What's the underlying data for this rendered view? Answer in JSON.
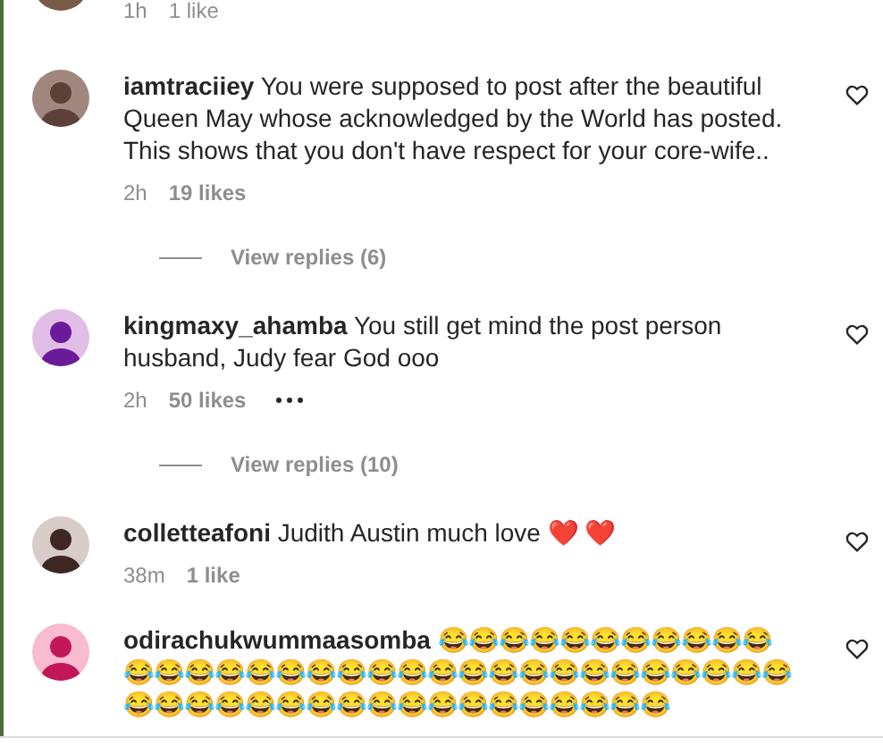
{
  "comments": [
    {
      "kind": "partial",
      "time": "1h",
      "likes": "1 like"
    },
    {
      "username": "iamtraciiey",
      "text": "You were supposed to post after the beautiful Queen May whose acknowledged by the World has posted. This shows that you don't have respect for your core-wife..",
      "time": "2h",
      "likes": "19 likes",
      "more": false,
      "replies": "View replies (6)",
      "kind": "comment"
    },
    {
      "username": "kingmaxy_ahamba",
      "text": "You still get mind the post person husband, Judy fear God ooo",
      "time": "2h",
      "likes": "50 likes",
      "more": true,
      "replies": "View replies (10)",
      "kind": "comment"
    },
    {
      "username": "colletteafoni",
      "text": "Judith Austin much love ❤️ ❤️",
      "time": "38m",
      "likes": "1 like",
      "more": false,
      "kind": "comment"
    },
    {
      "username": "odirachukwummaasomba",
      "text": "😂😂😂😂😂😂😂😂😂😂😂😂😂😂😂😂😂😂😂😂😂😂😂😂😂😂😂😂😂😂😂😂😂😂😂😂😂😂😂😂😂😂😂😂😂😂😂😂😂😂😂",
      "kind": "comment"
    }
  ]
}
